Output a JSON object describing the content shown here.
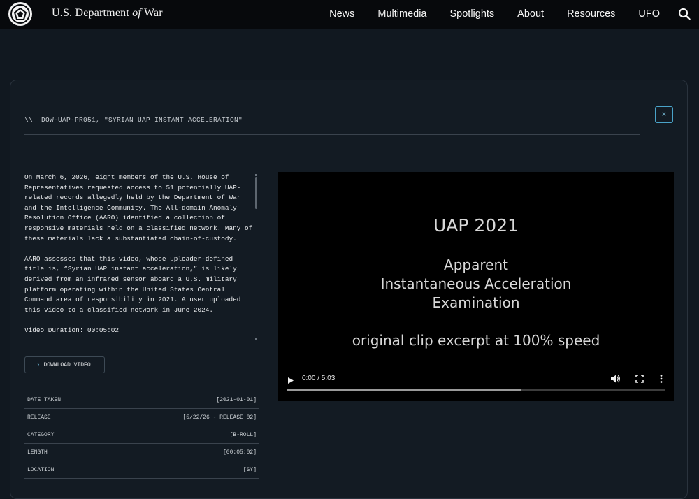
{
  "header": {
    "site_title_prefix": "U.S. Department ",
    "site_title_of": "of",
    "site_title_suffix": " War",
    "nav": [
      "News",
      "Multimedia",
      "Spotlights",
      "About",
      "Resources",
      "UFO"
    ]
  },
  "record": {
    "id_line": "\\\\  DOW-UAP-PR051, \"SYRIAN UAP INSTANT ACCELERATION\"",
    "close_label": "X",
    "paragraphs": [
      "On March 6, 2026, eight members of the U.S. House of Representatives requested access to 51 potentially UAP-related records allegedly held by the Department of War and the Intelligence Community. The All-domain Anomaly Resolution Office (AARO) identified a collection of responsive materials held on a classified network. Many of these materials lack a substantiated chain-of-custody.",
      "AARO assesses that this video, whose uploader-defined title is, “Syrian UAP instant acceleration,” is likely derived from an infrared sensor aboard a U.S. military platform operating within the United States Central Command area of responsibility in 2021. A user uploaded this video to a classified network in June 2024.",
      "Video Duration: 00:05:02"
    ],
    "download_label": "DOWNLOAD VIDEO",
    "metadata": [
      {
        "label": "DATE TAKEN",
        "value": "[2021-01-01]"
      },
      {
        "label": "RELEASE",
        "value": "[5/22/26 - RELEASE 02]"
      },
      {
        "label": "CATEGORY",
        "value": "[B-ROLL]"
      },
      {
        "label": "LENGTH",
        "value": "[00:05:02]"
      },
      {
        "label": "LOCATION",
        "value": "[SY]"
      }
    ]
  },
  "video": {
    "frame_title": "UAP 2021",
    "frame_lines": [
      "Apparent",
      "Instantaneous Acceleration",
      "Examination"
    ],
    "frame_caption": "original clip excerpt at 100% speed",
    "time": "0:00 / 5:03",
    "buffered_fraction": 0.62
  },
  "colors": {
    "accent": "#4aa3c8",
    "background": "#111820",
    "topbar": "#07090c"
  }
}
